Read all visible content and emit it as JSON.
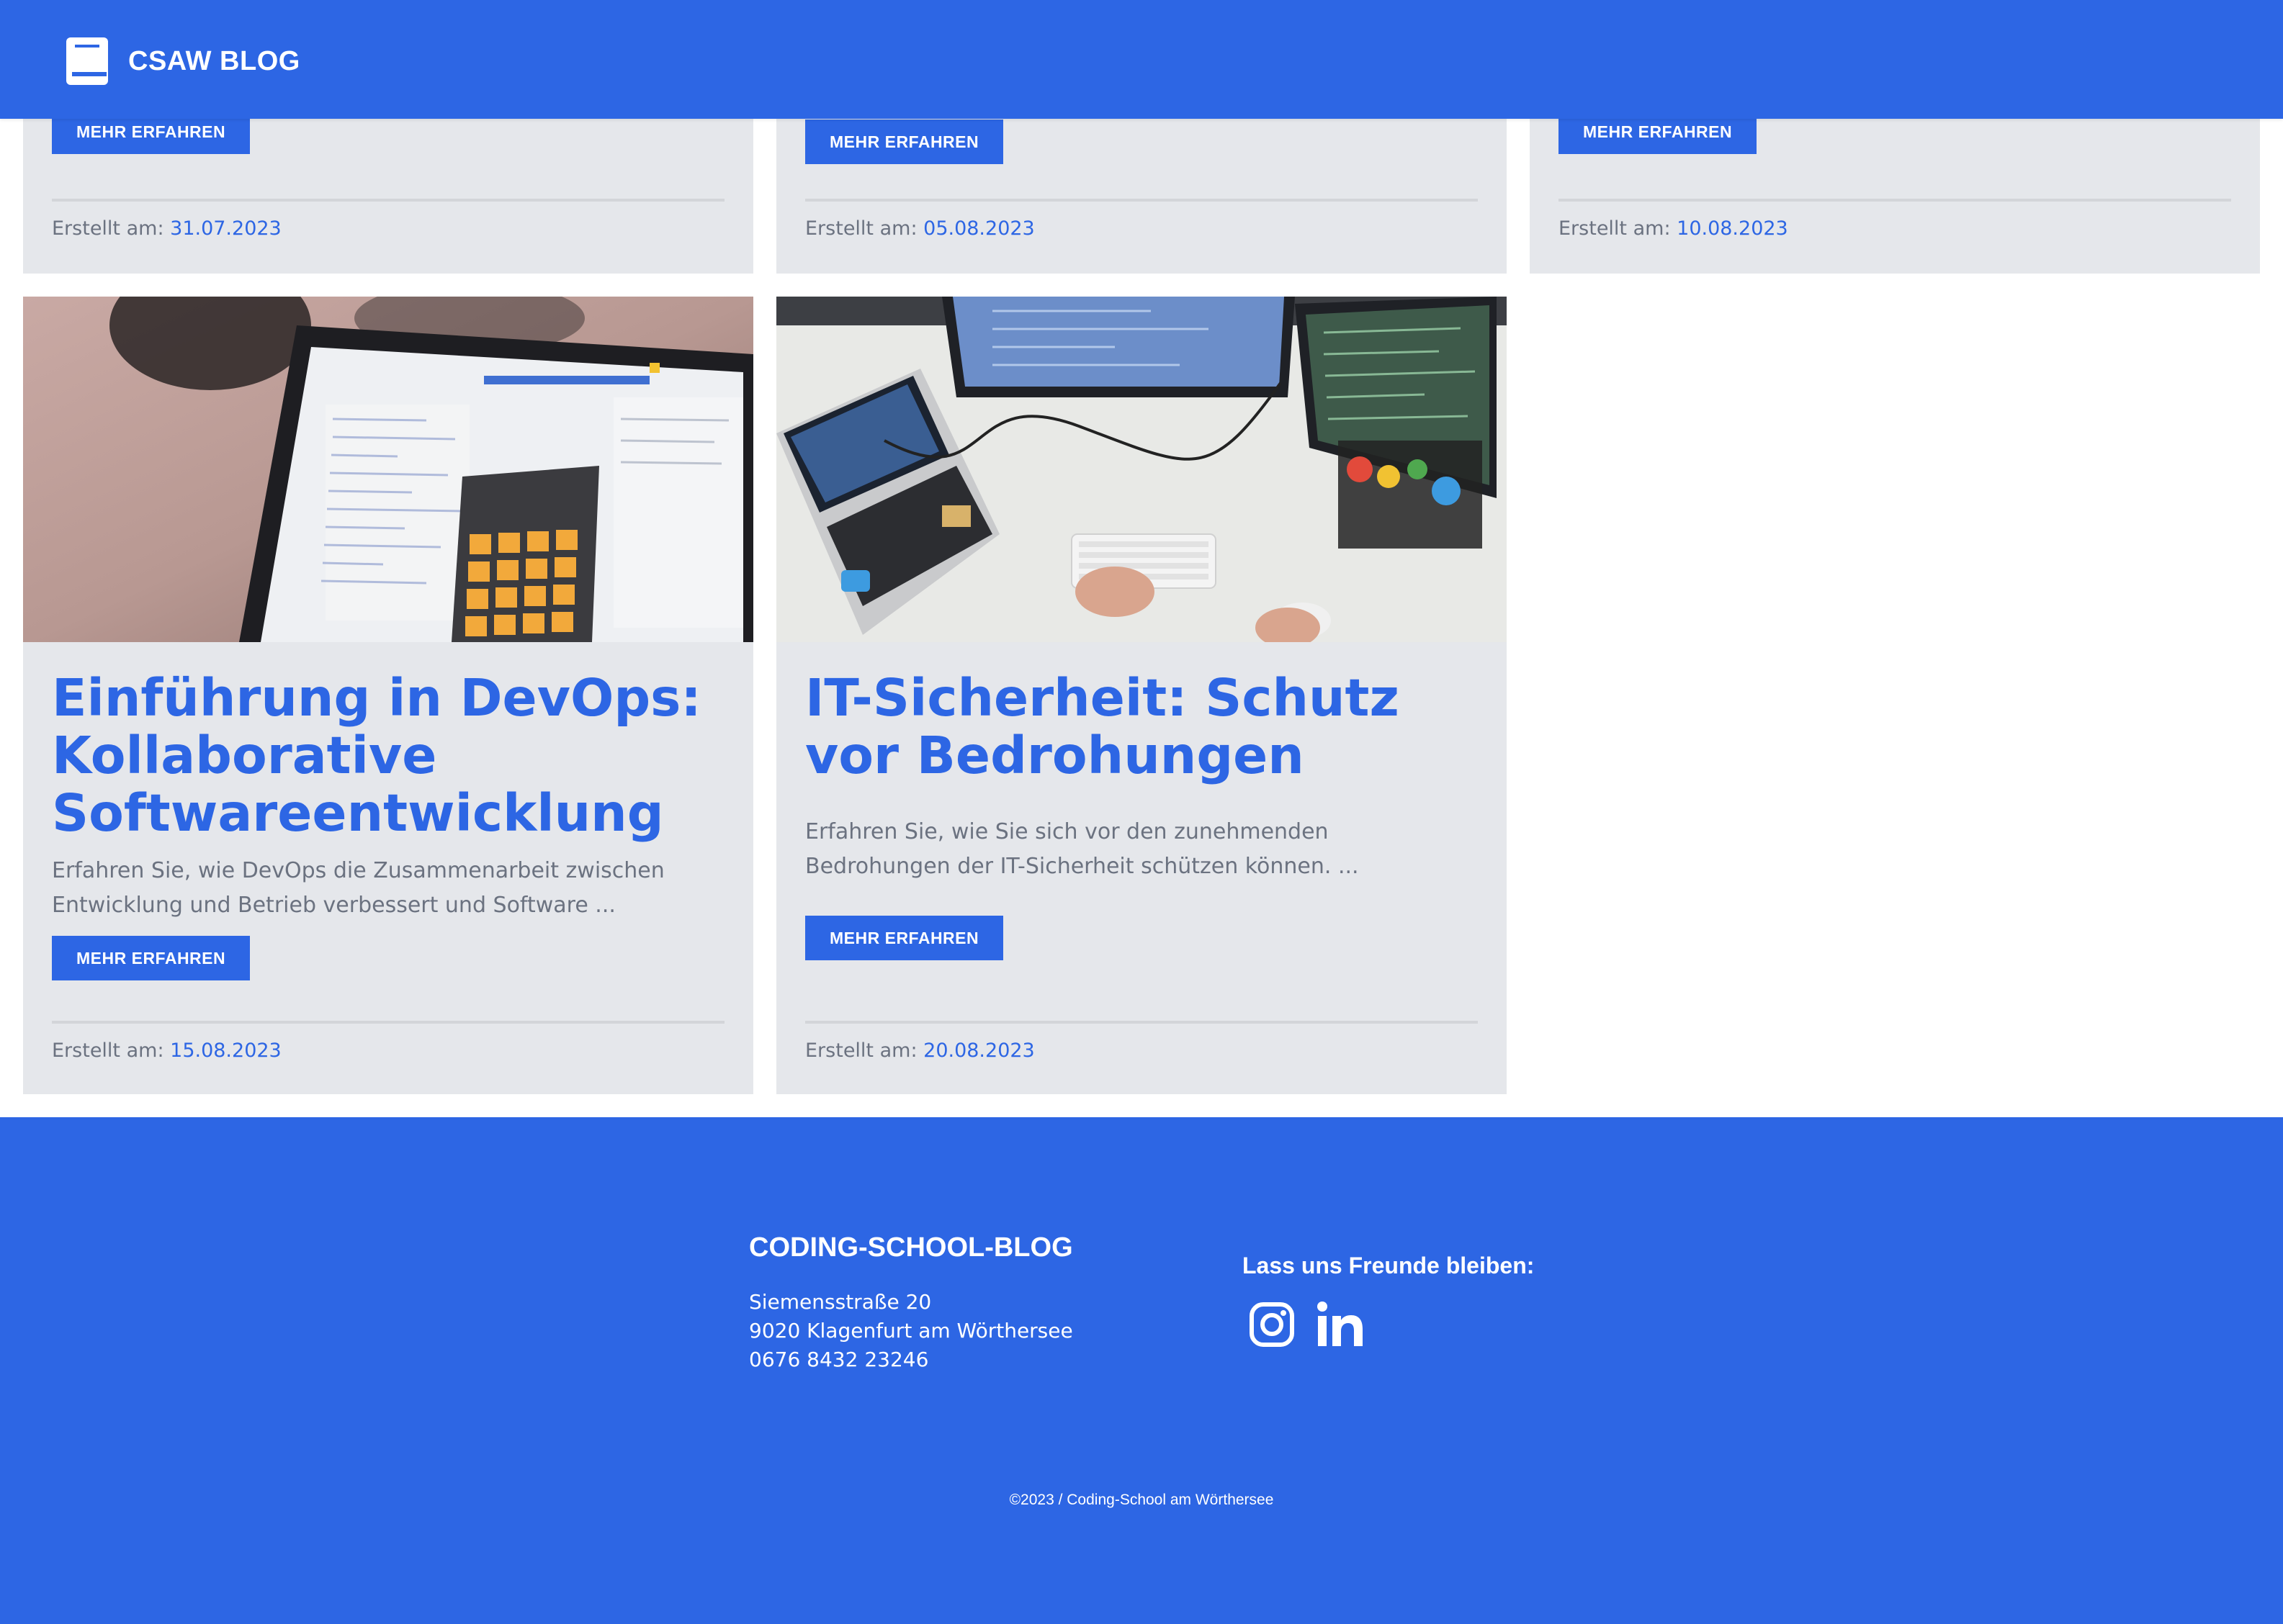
{
  "header": {
    "brand": "CSAW BLOG",
    "logo_icon": "book-icon",
    "background": "#2d66e4"
  },
  "top_cards": [
    {
      "button": "MEHR ERFAHREN",
      "created_label": "Erstellt am:",
      "date": "31.07.2023"
    },
    {
      "button": "MEHR ERFAHREN",
      "created_label": "Erstellt am:",
      "date": "05.08.2023"
    },
    {
      "button": "MEHR ERFAHREN",
      "created_label": "Erstellt am:",
      "date": "10.08.2023"
    }
  ],
  "posts": [
    {
      "title": "Einführung in DevOps: Kollaborative Softwareentwicklung",
      "excerpt": "Erfahren Sie, wie DevOps die Zusammenarbeit zwischen Entwicklung und Betrieb verbessert und Software ...",
      "button": "MEHR ERFAHREN",
      "created_label": "Erstellt am:",
      "date": "15.08.2023",
      "image_icon": "laptop-calculator-photo"
    },
    {
      "title": "IT-Sicherheit: Schutz vor Bedrohungen",
      "excerpt": "Erfahren Sie, wie Sie sich vor den zunehmenden Bedrohungen der IT-Sicherheit schützen können. ...",
      "button": "MEHR ERFAHREN",
      "created_label": "Erstellt am:",
      "date": "20.08.2023",
      "image_icon": "desk-monitors-photo"
    }
  ],
  "footer": {
    "title": "CODING-SCHOOL-BLOG",
    "address_line1": "Siemensstraße 20",
    "address_line2": "9020 Klagenfurt am Wörthersee",
    "phone": "0676 8432 23246",
    "social_title": "Lass uns Freunde bleiben:",
    "social_icons": [
      "instagram-icon",
      "linkedin-icon"
    ],
    "copyright": "©2023 / Coding-School am Wörthersee"
  },
  "colors": {
    "accent": "#2d66e4",
    "card_bg": "#e5e7eb",
    "muted_text": "#6b7280"
  }
}
